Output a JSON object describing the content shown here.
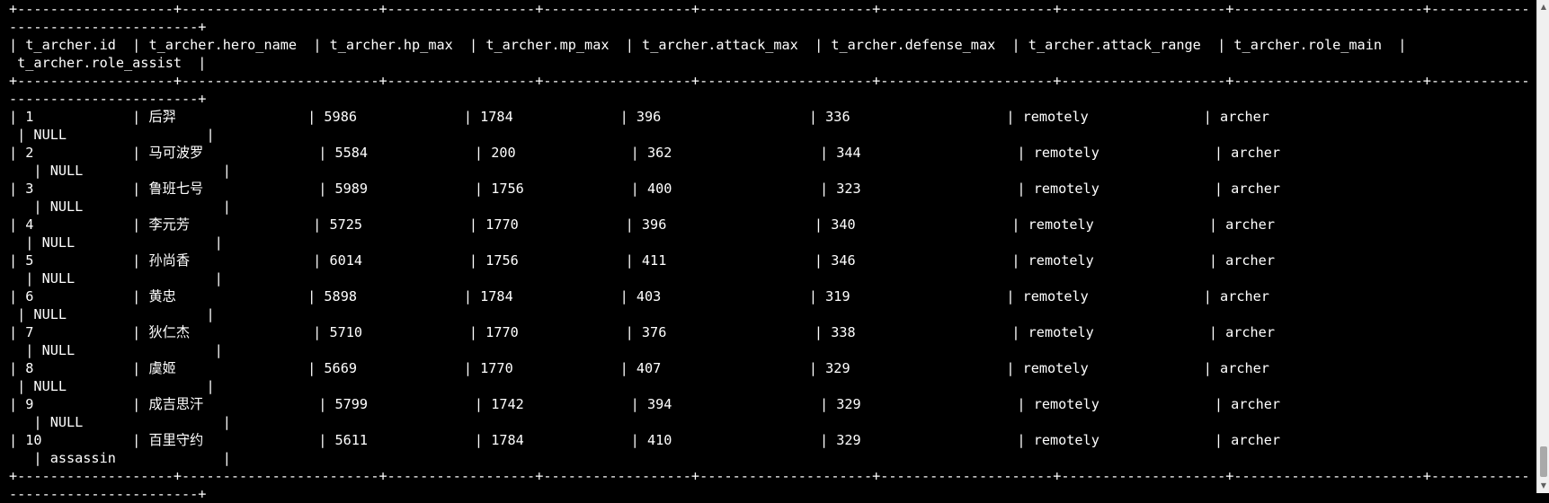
{
  "terminal": {
    "lines": [
      "+-------------------+------------------------+------------------+------------------+---------------------+---------------------+--------------------+-----------------------+------------------",
      "-----------------------+",
      "| t_archer.id  | t_archer.hero_name  | t_archer.hp_max  | t_archer.mp_max  | t_archer.attack_max  | t_archer.defense_max  | t_archer.attack_range  | t_archer.role_main  |",
      " t_archer.role_assist  |",
      "+-------------------+------------------------+------------------+------------------+---------------------+---------------------+--------------------+-----------------------+------------------",
      "-----------------------+",
      "| 1            | 后羿                | 5986             | 1784             | 396                  | 336                   | remotely              | archer",
      " | NULL                 |",
      "| 2            | 马可波罗              | 5584             | 200              | 362                  | 344                   | remotely              | archer",
      "   | NULL                 |",
      "| 3            | 鲁班七号              | 5989             | 1756             | 400                  | 323                   | remotely              | archer",
      "   | NULL                 |",
      "| 4            | 李元芳               | 5725             | 1770             | 396                  | 340                   | remotely              | archer",
      "  | NULL                 |",
      "| 5            | 孙尚香               | 6014             | 1756             | 411                  | 346                   | remotely              | archer",
      "  | NULL                 |",
      "| 6            | 黄忠                | 5898             | 1784             | 403                  | 319                   | remotely              | archer",
      " | NULL                 |",
      "| 7            | 狄仁杰               | 5710             | 1770             | 376                  | 338                   | remotely              | archer",
      "  | NULL                 |",
      "| 8            | 虞姬                | 5669             | 1770             | 407                  | 329                   | remotely              | archer",
      " | NULL                 |",
      "| 9            | 成吉思汗              | 5799             | 1742             | 394                  | 329                   | remotely              | archer",
      "   | NULL                 |",
      "| 10           | 百里守约              | 5611             | 1784             | 410                  | 329                   | remotely              | archer",
      "   | assassin             |",
      "+-------------------+------------------------+------------------+------------------+---------------------+---------------------+--------------------+-----------------------+------------------",
      "-----------------------+"
    ]
  },
  "scrollbar": {
    "up_icon": "▲",
    "down_icon": "▼"
  }
}
